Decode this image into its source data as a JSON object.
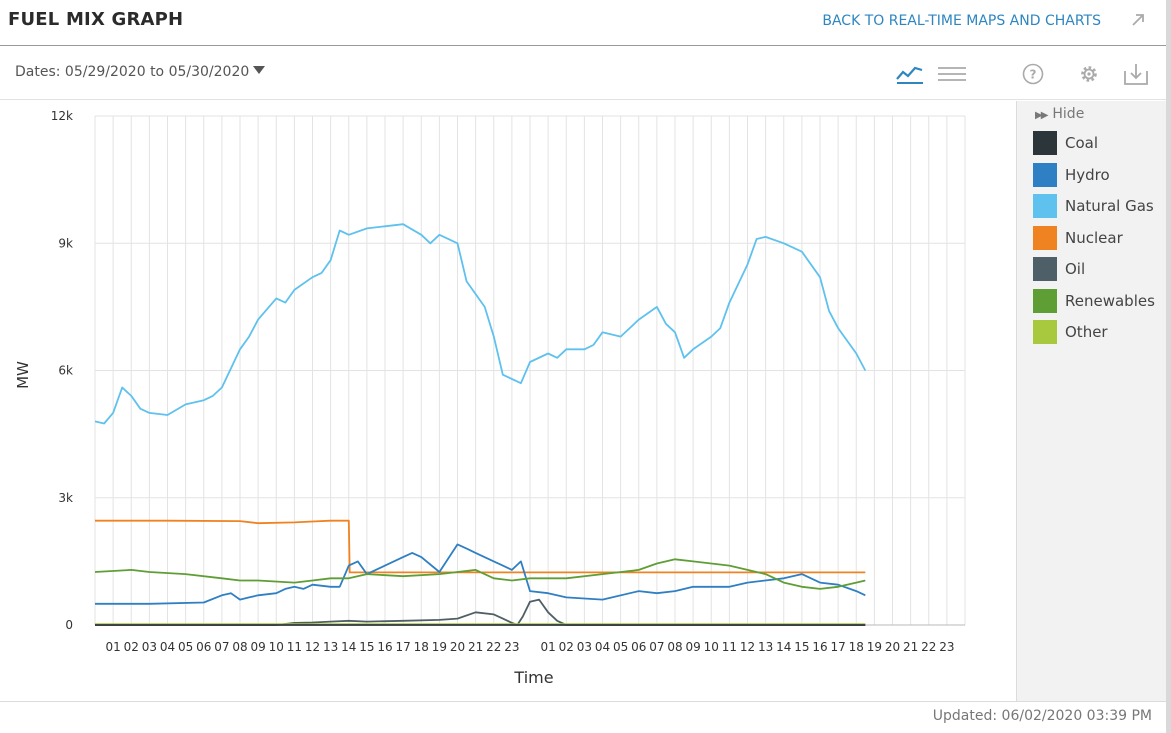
{
  "header": {
    "title": "FUEL MIX GRAPH",
    "back_link": "BACK TO REAL-TIME MAPS AND CHARTS",
    "expand_icon": "diagonal-arrow-icon"
  },
  "toolbar": {
    "dates_label": "Dates: 05/29/2020 to 05/30/2020",
    "icons": [
      "line-chart-icon",
      "table-view-icon",
      "help-icon",
      "gear-icon",
      "download-icon"
    ],
    "active_color": "#2e86c1"
  },
  "legend": {
    "hide_label": "Hide",
    "items": [
      {
        "name": "Coal",
        "color": "#2c353a"
      },
      {
        "name": "Hydro",
        "color": "#2e7fc4"
      },
      {
        "name": "Natural Gas",
        "color": "#5ec1ee"
      },
      {
        "name": "Nuclear",
        "color": "#f08321"
      },
      {
        "name": "Oil",
        "color": "#4f5f68"
      },
      {
        "name": "Renewables",
        "color": "#5e9e35"
      },
      {
        "name": "Other",
        "color": "#a8c93e"
      }
    ]
  },
  "footer": {
    "updated": "Updated: 06/02/2020 03:39 PM"
  },
  "chart_data": {
    "type": "line",
    "xlabel": "Time",
    "ylabel": "MW",
    "x_unit": "hours",
    "xlim": [
      0,
      48
    ],
    "ylim": [
      0,
      12000
    ],
    "yticks": [
      {
        "value": 0,
        "label": "0"
      },
      {
        "value": 3000,
        "label": "3k"
      },
      {
        "value": 6000,
        "label": "6k"
      },
      {
        "value": 9000,
        "label": "9k"
      },
      {
        "value": 12000,
        "label": "12k"
      }
    ],
    "xtick_labels": [
      "01",
      "02",
      "03",
      "04",
      "05",
      "06",
      "07",
      "08",
      "09",
      "10",
      "11",
      "12",
      "13",
      "14",
      "15",
      "16",
      "17",
      "18",
      "19",
      "20",
      "21",
      "22",
      "23",
      "",
      "01",
      "02",
      "03",
      "04",
      "05",
      "06",
      "07",
      "08",
      "09",
      "10",
      "11",
      "12",
      "13",
      "14",
      "15",
      "16",
      "17",
      "18",
      "19",
      "20",
      "21",
      "22",
      "23"
    ],
    "grid": true,
    "series": [
      {
        "name": "Natural Gas",
        "color": "#5ec1ee",
        "points": [
          [
            0,
            4800
          ],
          [
            0.5,
            4750
          ],
          [
            1,
            5000
          ],
          [
            1.5,
            5600
          ],
          [
            2,
            5400
          ],
          [
            2.5,
            5100
          ],
          [
            3,
            5000
          ],
          [
            4,
            4950
          ],
          [
            5,
            5200
          ],
          [
            6,
            5300
          ],
          [
            6.5,
            5400
          ],
          [
            7,
            5600
          ],
          [
            8,
            6500
          ],
          [
            8.5,
            6800
          ],
          [
            9,
            7200
          ],
          [
            10,
            7700
          ],
          [
            10.5,
            7600
          ],
          [
            11,
            7900
          ],
          [
            12,
            8200
          ],
          [
            12.5,
            8300
          ],
          [
            13,
            8600
          ],
          [
            13.5,
            9300
          ],
          [
            14,
            9200
          ],
          [
            15,
            9350
          ],
          [
            16,
            9400
          ],
          [
            17,
            9450
          ],
          [
            18,
            9200
          ],
          [
            18.5,
            9000
          ],
          [
            19,
            9200
          ],
          [
            20,
            9000
          ],
          [
            20.5,
            8100
          ],
          [
            21.5,
            7500
          ],
          [
            22,
            6800
          ],
          [
            22.5,
            5900
          ],
          [
            23,
            5800
          ],
          [
            23.5,
            5700
          ],
          [
            24,
            6200
          ],
          [
            25,
            6400
          ],
          [
            25.5,
            6300
          ],
          [
            26,
            6500
          ],
          [
            27,
            6500
          ],
          [
            27.5,
            6600
          ],
          [
            28,
            6900
          ],
          [
            29,
            6800
          ],
          [
            29.5,
            7000
          ],
          [
            30,
            7200
          ],
          [
            31,
            7500
          ],
          [
            31.5,
            7100
          ],
          [
            32,
            6900
          ],
          [
            32.5,
            6300
          ],
          [
            33,
            6500
          ],
          [
            34,
            6800
          ],
          [
            34.5,
            7000
          ],
          [
            35,
            7600
          ],
          [
            36,
            8500
          ],
          [
            36.5,
            9100
          ],
          [
            37,
            9150
          ],
          [
            38,
            9000
          ],
          [
            39,
            8800
          ],
          [
            40,
            8200
          ],
          [
            40.5,
            7400
          ],
          [
            41,
            7000
          ],
          [
            42,
            6400
          ],
          [
            42.5,
            6000
          ]
        ]
      },
      {
        "name": "Nuclear",
        "color": "#f08321",
        "points": [
          [
            0,
            2460
          ],
          [
            4,
            2460
          ],
          [
            8,
            2450
          ],
          [
            9,
            2400
          ],
          [
            11,
            2420
          ],
          [
            12,
            2440
          ],
          [
            13,
            2460
          ],
          [
            14,
            2460
          ],
          [
            14.05,
            1240
          ],
          [
            20,
            1240
          ],
          [
            30,
            1240
          ],
          [
            42.5,
            1240
          ]
        ]
      },
      {
        "name": "Hydro",
        "color": "#2e7fc4",
        "points": [
          [
            0,
            500
          ],
          [
            3,
            500
          ],
          [
            6,
            530
          ],
          [
            7,
            700
          ],
          [
            7.5,
            750
          ],
          [
            8,
            600
          ],
          [
            8.5,
            650
          ],
          [
            9,
            700
          ],
          [
            10,
            750
          ],
          [
            10.5,
            850
          ],
          [
            11,
            900
          ],
          [
            11.5,
            850
          ],
          [
            12,
            950
          ],
          [
            13,
            900
          ],
          [
            13.5,
            900
          ],
          [
            14,
            1400
          ],
          [
            14.5,
            1500
          ],
          [
            15,
            1200
          ],
          [
            16,
            1400
          ],
          [
            17,
            1600
          ],
          [
            17.5,
            1700
          ],
          [
            18,
            1600
          ],
          [
            19,
            1250
          ],
          [
            20,
            1900
          ],
          [
            20.5,
            1800
          ],
          [
            21,
            1700
          ],
          [
            22,
            1500
          ],
          [
            22.5,
            1400
          ],
          [
            23,
            1300
          ],
          [
            23.5,
            1500
          ],
          [
            24,
            800
          ],
          [
            25,
            750
          ],
          [
            26,
            650
          ],
          [
            28,
            600
          ],
          [
            30,
            800
          ],
          [
            31,
            750
          ],
          [
            32,
            800
          ],
          [
            33,
            900
          ],
          [
            35,
            900
          ],
          [
            36,
            1000
          ],
          [
            38,
            1100
          ],
          [
            39,
            1200
          ],
          [
            40,
            1000
          ],
          [
            41,
            950
          ],
          [
            42,
            800
          ],
          [
            42.5,
            700
          ]
        ]
      },
      {
        "name": "Renewables",
        "color": "#5e9e35",
        "points": [
          [
            0,
            1250
          ],
          [
            2,
            1300
          ],
          [
            3,
            1250
          ],
          [
            5,
            1200
          ],
          [
            7,
            1100
          ],
          [
            8,
            1050
          ],
          [
            9,
            1050
          ],
          [
            11,
            1000
          ],
          [
            12,
            1050
          ],
          [
            13,
            1100
          ],
          [
            14,
            1100
          ],
          [
            15,
            1200
          ],
          [
            17,
            1150
          ],
          [
            19,
            1200
          ],
          [
            21,
            1300
          ],
          [
            22,
            1100
          ],
          [
            23,
            1050
          ],
          [
            24,
            1100
          ],
          [
            26,
            1100
          ],
          [
            28,
            1200
          ],
          [
            30,
            1300
          ],
          [
            31,
            1450
          ],
          [
            32,
            1550
          ],
          [
            33,
            1500
          ],
          [
            34,
            1450
          ],
          [
            35,
            1400
          ],
          [
            36,
            1300
          ],
          [
            37,
            1200
          ],
          [
            38,
            1000
          ],
          [
            39,
            900
          ],
          [
            40,
            850
          ],
          [
            41,
            900
          ],
          [
            42,
            1000
          ],
          [
            42.5,
            1050
          ]
        ]
      },
      {
        "name": "Oil",
        "color": "#4f5f68",
        "points": [
          [
            0,
            0
          ],
          [
            10,
            0
          ],
          [
            11,
            50
          ],
          [
            12,
            60
          ],
          [
            13,
            80
          ],
          [
            14,
            100
          ],
          [
            15,
            80
          ],
          [
            17,
            100
          ],
          [
            19,
            120
          ],
          [
            20,
            150
          ],
          [
            21,
            300
          ],
          [
            22,
            250
          ],
          [
            22.5,
            150
          ],
          [
            23,
            50
          ],
          [
            23.3,
            0
          ],
          [
            23.6,
            200
          ],
          [
            24,
            550
          ],
          [
            24.5,
            600
          ],
          [
            25,
            300
          ],
          [
            25.5,
            100
          ],
          [
            26,
            0
          ],
          [
            42.5,
            0
          ]
        ]
      },
      {
        "name": "Other",
        "color": "#a8c93e",
        "points": [
          [
            0,
            20
          ],
          [
            42.5,
            20
          ]
        ]
      },
      {
        "name": "Coal",
        "color": "#2c353a",
        "points": [
          [
            0,
            0
          ],
          [
            42.5,
            0
          ]
        ]
      }
    ]
  }
}
